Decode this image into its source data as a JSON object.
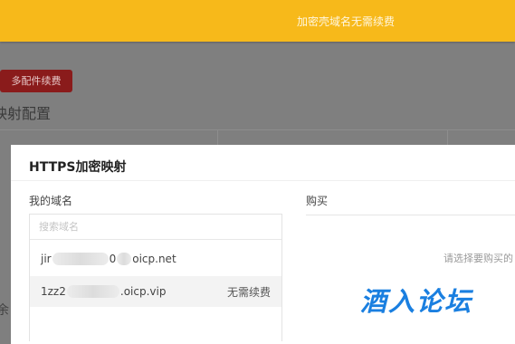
{
  "topbar": {
    "message": "加密壳域名无需续费"
  },
  "background": {
    "badge_label": "多配件续费",
    "heading": "映射配置",
    "left_glyph": "余"
  },
  "modal": {
    "title": "HTTPS加密映射",
    "domains": {
      "label": "我的域名",
      "search_placeholder": "搜索域名",
      "rows": [
        {
          "prefix": "jir",
          "suffix": "0",
          "tld": "oicp.net",
          "status": ""
        },
        {
          "prefix": "1zz2",
          "suffix": "",
          "tld": ".oicp.vip",
          "status": "无需续费"
        }
      ]
    },
    "buy": {
      "label": "购买",
      "hint": "请选择要购买的"
    }
  },
  "watermark": {
    "text": "酒入论坛"
  },
  "colors": {
    "topbar": "#f7b91a",
    "badge": "#8a1b1b",
    "watermark": "#1a7fe0"
  }
}
